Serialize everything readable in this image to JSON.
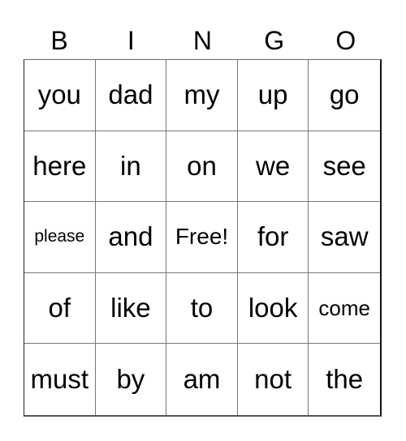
{
  "header": [
    "B",
    "I",
    "N",
    "G",
    "O"
  ],
  "cells": [
    {
      "text": "you",
      "size": ""
    },
    {
      "text": "dad",
      "size": ""
    },
    {
      "text": "my",
      "size": ""
    },
    {
      "text": "up",
      "size": ""
    },
    {
      "text": "go",
      "size": ""
    },
    {
      "text": "here",
      "size": ""
    },
    {
      "text": "in",
      "size": ""
    },
    {
      "text": "on",
      "size": ""
    },
    {
      "text": "we",
      "size": ""
    },
    {
      "text": "see",
      "size": ""
    },
    {
      "text": "please",
      "size": "sm"
    },
    {
      "text": "and",
      "size": ""
    },
    {
      "text": "Free!",
      "size": "free"
    },
    {
      "text": "for",
      "size": ""
    },
    {
      "text": "saw",
      "size": ""
    },
    {
      "text": "of",
      "size": ""
    },
    {
      "text": "like",
      "size": ""
    },
    {
      "text": "to",
      "size": ""
    },
    {
      "text": "look",
      "size": ""
    },
    {
      "text": "come",
      "size": "md"
    },
    {
      "text": "must",
      "size": ""
    },
    {
      "text": "by",
      "size": ""
    },
    {
      "text": "am",
      "size": ""
    },
    {
      "text": "not",
      "size": ""
    },
    {
      "text": "the",
      "size": ""
    }
  ]
}
